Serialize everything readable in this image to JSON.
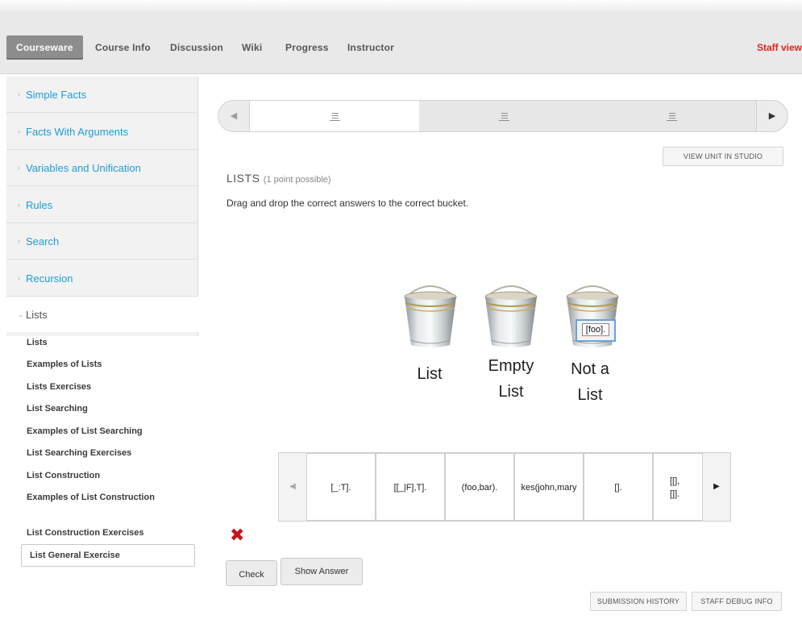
{
  "topnav": {
    "tabs": [
      {
        "label": "Courseware",
        "active": true
      },
      {
        "label": "Course Info"
      },
      {
        "label": "Discussion"
      },
      {
        "label": "Wiki"
      },
      {
        "label": "Progress"
      },
      {
        "label": "Instructor"
      }
    ],
    "staff_label": "Staff view"
  },
  "sidebar": {
    "chapters": [
      {
        "label": "Simple Facts"
      },
      {
        "label": "Facts With Arguments"
      },
      {
        "label": "Variables and Unification"
      },
      {
        "label": "Rules"
      },
      {
        "label": "Search"
      },
      {
        "label": "Recursion"
      },
      {
        "label": "Lists",
        "open": true
      }
    ],
    "sections": [
      "Lists",
      "Examples of Lists",
      "Lists Exercises",
      "List Searching",
      "Examples of List Searching",
      "List Searching Exercises",
      "List Construction",
      "Examples of List Construction",
      "List Construction Exercises",
      "List General Exercise"
    ],
    "active_section": "List General Exercise"
  },
  "sequence": {
    "items": [
      "unit-1",
      "unit-2",
      "unit-3"
    ],
    "active_index": 0
  },
  "main": {
    "studio_button": "VIEW UNIT IN STUDIO",
    "problem_title": "LISTS",
    "problem_points": "(1 point possible)",
    "problem_text": "Drag and drop the correct answers to the correct bucket.",
    "buckets": [
      {
        "label_line1": "List",
        "label_line2": ""
      },
      {
        "label_line1": "Empty",
        "label_line2": "List"
      },
      {
        "label_line1": "Not a",
        "label_line2": "List"
      }
    ],
    "dropped_item": "[foo].",
    "options": [
      "[_:T].",
      "[[_|F],T].",
      "(foo,bar).",
      "kes(john,mary",
      "[].",
      "[[],",
      "[]]."
    ],
    "check_label": "Check",
    "show_answer_label": "Show Answer",
    "submission_history_label": "SUBMISSION HISTORY",
    "staff_debug_label": "STAFF DEBUG INFO"
  },
  "colors": {
    "link": "#1d9dd9",
    "staff": "#e5231c",
    "error": "#c4151c",
    "active_tab": "#8d8d8d"
  },
  "icons": [
    "list-icon",
    "bucket-icon",
    "incorrect-x-icon",
    "chevron-left-icon",
    "chevron-right-icon"
  ]
}
